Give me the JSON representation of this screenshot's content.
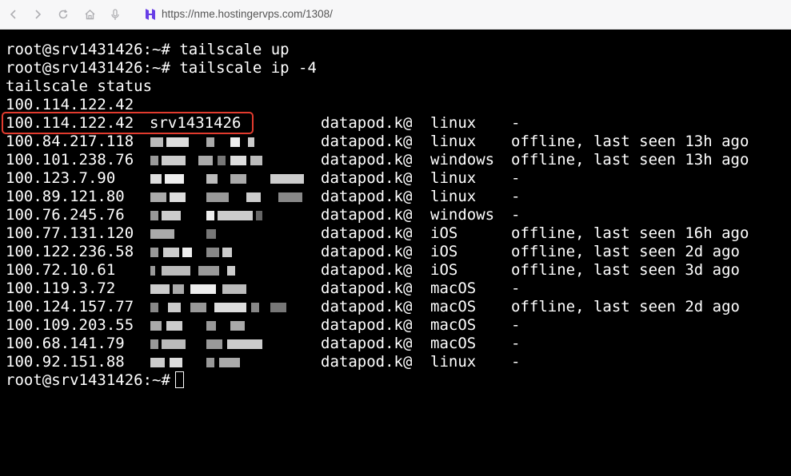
{
  "browser": {
    "url": "https://nme.hostingervps.com/1308/",
    "back_icon": "chevron-left-icon",
    "forward_icon": "chevron-right-icon",
    "reload_icon": "reload-icon",
    "home_icon": "home-icon",
    "mic_icon": "microphone-icon",
    "site_icon": "hostinger-logo-icon",
    "site_icon_color": "#673de6"
  },
  "terminal": {
    "commands": [
      "root@srv1431426:~# tailscale up",
      "root@srv1431426:~# tailscale ip -4",
      "tailscale status",
      "100.114.122.42"
    ],
    "devices": [
      {
        "ip": "100.114.122.42",
        "host": "srv1431426",
        "user": "datapod.k@",
        "os": "linux",
        "status": "-"
      },
      {
        "ip": "100.84.217.118",
        "host": "",
        "user": "datapod.k@",
        "os": "linux",
        "status": "offline, last seen 13h ago"
      },
      {
        "ip": "100.101.238.76",
        "host": "",
        "user": "datapod.k@",
        "os": "windows",
        "status": "offline, last seen 13h ago"
      },
      {
        "ip": "100.123.7.90",
        "host": "",
        "user": "datapod.k@",
        "os": "linux",
        "status": "-"
      },
      {
        "ip": "100.89.121.80",
        "host": "",
        "user": "datapod.k@",
        "os": "linux",
        "status": "-"
      },
      {
        "ip": "100.76.245.76",
        "host": "",
        "user": "datapod.k@",
        "os": "windows",
        "status": "-"
      },
      {
        "ip": "100.77.131.120",
        "host": "",
        "user": "datapod.k@",
        "os": "iOS",
        "status": "offline, last seen 16h ago"
      },
      {
        "ip": "100.122.236.58",
        "host": "",
        "user": "datapod.k@",
        "os": "iOS",
        "status": "offline, last seen 2d ago"
      },
      {
        "ip": "100.72.10.61",
        "host": "",
        "user": "datapod.k@",
        "os": "iOS",
        "status": "offline, last seen 3d ago"
      },
      {
        "ip": "100.119.3.72",
        "host": "",
        "user": "datapod.k@",
        "os": "macOS",
        "status": "-"
      },
      {
        "ip": "100.124.157.77",
        "host": "",
        "user": "datapod.k@",
        "os": "macOS",
        "status": "offline, last seen 2d ago"
      },
      {
        "ip": "100.109.203.55",
        "host": "",
        "user": "datapod.k@",
        "os": "macOS",
        "status": "-"
      },
      {
        "ip": "100.68.141.79",
        "host": "",
        "user": "datapod.k@",
        "os": "macOS",
        "status": "-"
      },
      {
        "ip": "100.92.151.88",
        "host": "",
        "user": "datapod.k@",
        "os": "linux",
        "status": "-"
      }
    ],
    "prompt": "root@srv1431426:~#",
    "highlight_color": "#e23b2e"
  }
}
